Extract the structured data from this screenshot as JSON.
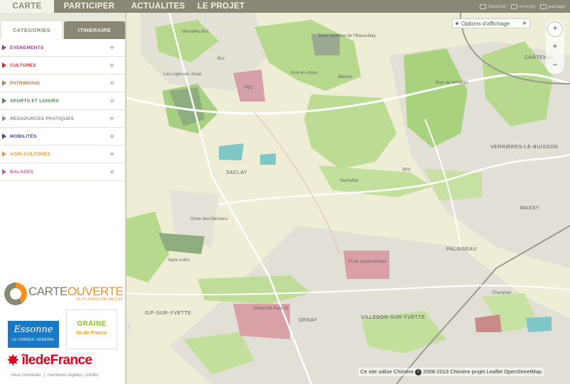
{
  "nav": {
    "items": [
      "CARTE",
      "PARTICIPER",
      "ACTUALITES",
      "LE PROJET"
    ],
    "tools": [
      "imprimer",
      "envoyer",
      "partager"
    ]
  },
  "sidebar": {
    "tabs": [
      "CATEGORIES",
      "ITINERAIRE"
    ],
    "categories": [
      {
        "label": "EVENEMENTS",
        "color": "#9b3d8c"
      },
      {
        "label": "CULTURES",
        "color": "#d9262b"
      },
      {
        "label": "PATRIMOINE",
        "color": "#c47a5a"
      },
      {
        "label": "SPORTS ET LOISIRS",
        "color": "#3e8f4a"
      },
      {
        "label": "RESSOURCES PRATIQUES",
        "color": "#8e8e8e"
      },
      {
        "label": "MOBILITES",
        "color": "#3a4f8c"
      },
      {
        "label": "AGRI-CULTURES",
        "color": "#e49a2a"
      },
      {
        "label": "BALADES",
        "color": "#c65aa0"
      }
    ],
    "logos": {
      "carte_a": "CARTE",
      "carte_b": "OUVERTE",
      "carte_sub": "DU PLATEAU DE SACLAY",
      "essonne_a": "Essonne",
      "essonne_b": "LE CONSEIL GÉNÉRAL",
      "graine_a": "GRAINE",
      "graine_b": "Ile-de-France",
      "idf_a": "îledeFrance"
    },
    "footer": {
      "contact": "nous contacter",
      "sep": "|",
      "legal": "mentions légales, crédits"
    }
  },
  "map": {
    "options_label": "Options d'affichage",
    "attribution": {
      "a": "Ce site utilise Chimère",
      "b": "2008-2013",
      "c": "Chimère projet",
      "d": "Leaflet",
      "e": "OpenStreetMap"
    },
    "labels": {
      "versailles": "Versailles-Buc",
      "buc": "Buc",
      "loges": "Les Loges-en-Josas",
      "jouy": "Jouy-en-Josas",
      "hec": "HEC",
      "bievres": "Bièvres",
      "saclay": "Saclay",
      "orsay": "Orsay",
      "gif": "GIF-SUR-YVETTE",
      "palaiseau": "PALAISEAU",
      "massy": "MASSY",
      "verrieres": "VERRIÈRES-LE-BUISSON",
      "chatenay": "CHÂTENAY",
      "villebon": "VILLEBON-SUR-YVETTE",
      "polytechnique": "École polytechnique",
      "universite": "Université Paris XI",
      "vauhallan": "Vauhallan",
      "igny": "Igny",
      "champlan": "Champlan",
      "chaumes": "Bois de Verrières",
      "orme": "Orme des Merisiers",
      "base": "Base aérienne de Villacoublay",
      "stauban": "Saint-Aubin"
    }
  }
}
